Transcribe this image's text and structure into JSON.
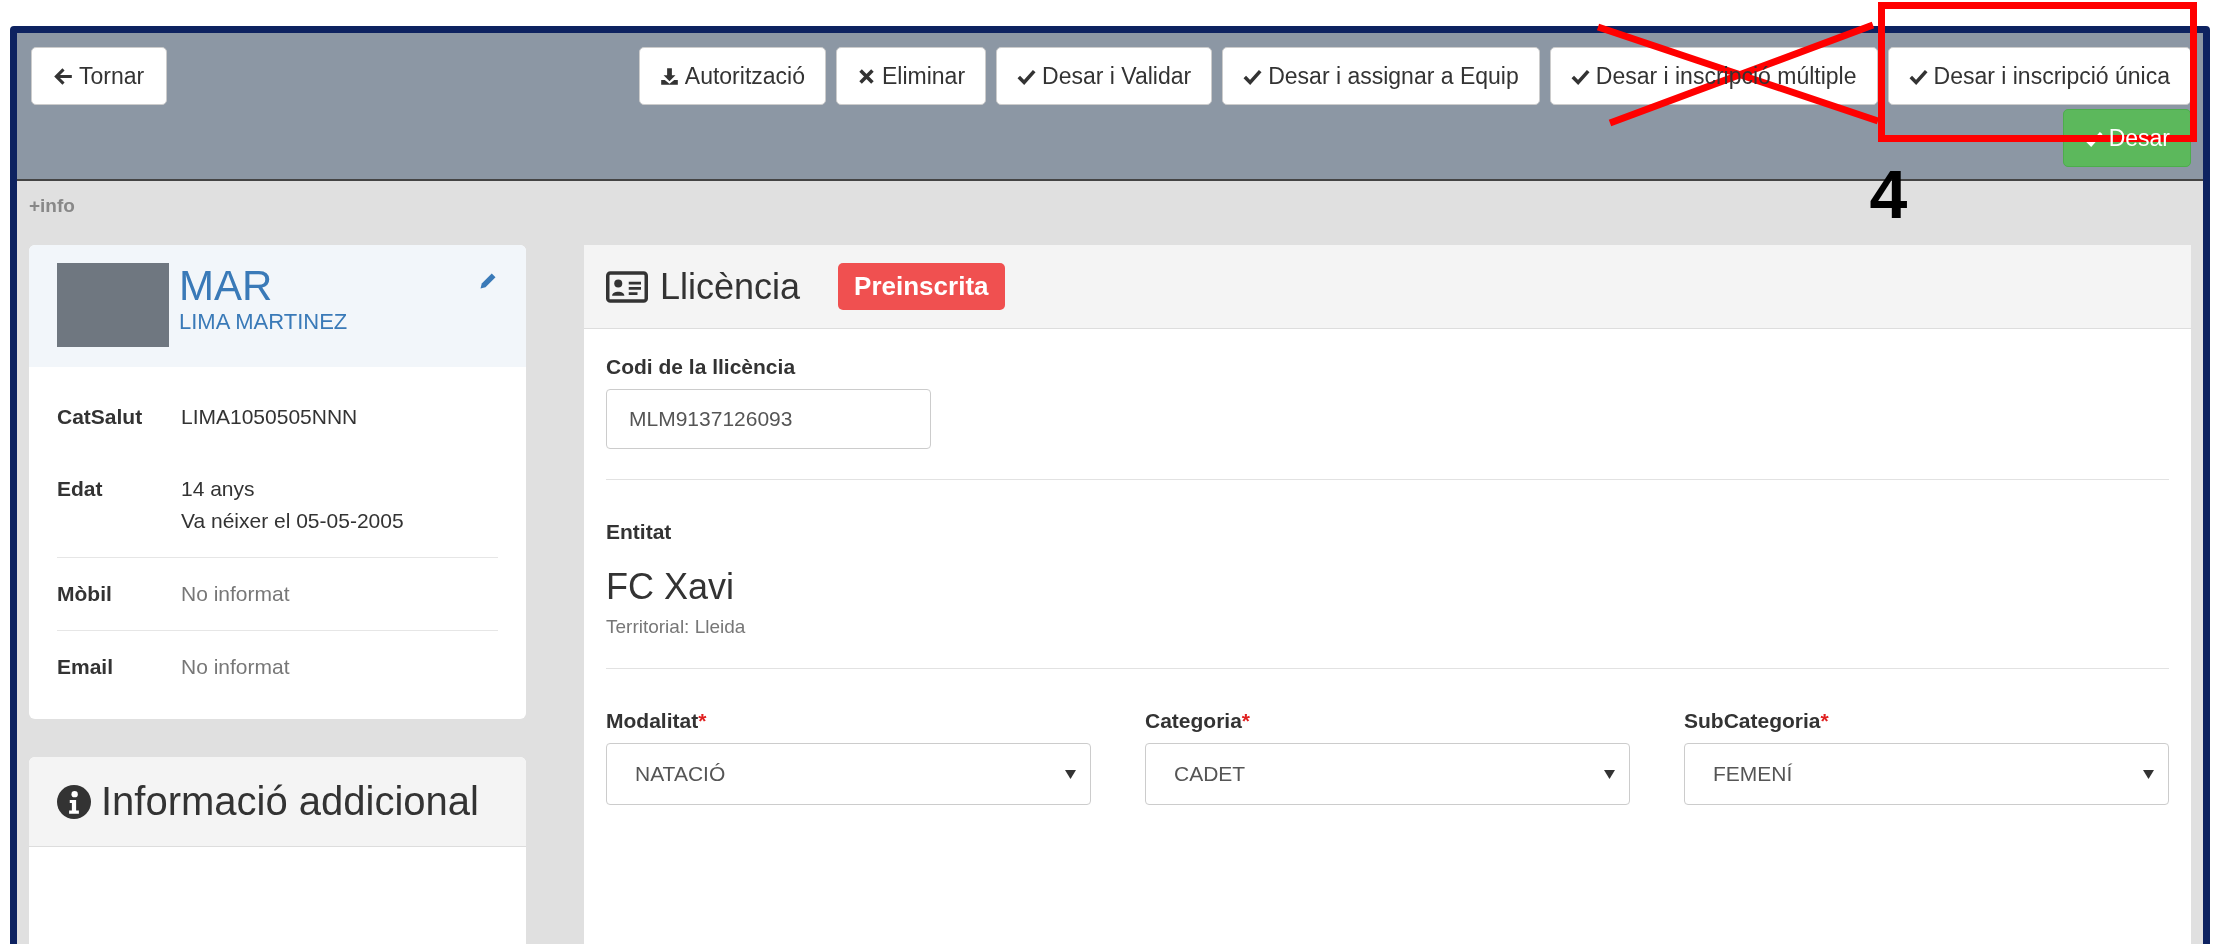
{
  "toolbar": {
    "back_button": "Tornar",
    "buttons": [
      {
        "label": "Autorització",
        "kind": "download",
        "crossed_out": false,
        "highlighted": false
      },
      {
        "label": "Eliminar",
        "kind": "delete",
        "crossed_out": false,
        "highlighted": false
      },
      {
        "label": "Desar i Validar",
        "kind": "save",
        "crossed_out": false,
        "highlighted": false
      },
      {
        "label": "Desar i assignar a Equip",
        "kind": "save",
        "crossed_out": false,
        "highlighted": false
      },
      {
        "label": "Desar i inscripció múltiple",
        "kind": "save",
        "crossed_out": true,
        "highlighted": false
      },
      {
        "label": "Desar i inscripció única",
        "kind": "save",
        "crossed_out": false,
        "highlighted": true
      }
    ],
    "save_button": "Desar"
  },
  "annotation_number": "4",
  "more_info": "+info",
  "profile": {
    "first_name": "MAR",
    "last_name": "LIMA MARTINEZ",
    "sections": [
      {
        "rows": [
          {
            "label": "CatSalut",
            "values": [
              "LIMA1050505NNN"
            ],
            "muted": false
          },
          {
            "label": "Edat",
            "values": [
              "14 anys",
              "Va néixer el 05-05-2005"
            ],
            "muted": false
          }
        ]
      },
      {
        "rows": [
          {
            "label": "Mòbil",
            "values": [
              "No informat"
            ],
            "muted": true
          }
        ]
      },
      {
        "rows": [
          {
            "label": "Email",
            "values": [
              "No informat"
            ],
            "muted": true
          }
        ]
      }
    ]
  },
  "additional_info": {
    "title": "Informació addicional"
  },
  "license": {
    "title": "Llicència",
    "status": "Preinscrita",
    "code_label": "Codi de la llicència",
    "code_value": "MLM9137126093",
    "entity_label": "Entitat",
    "entity_name": "FC Xavi",
    "entity_territory": "Territorial: Lleida",
    "selects": [
      {
        "label": "Modalitat",
        "required_mark": "*",
        "value": "NATACIÓ"
      },
      {
        "label": "Categoria",
        "required_mark": "*",
        "value": "CADET"
      },
      {
        "label": "SubCategoria",
        "required_mark": "*",
        "value": "FEMENÍ"
      }
    ]
  }
}
